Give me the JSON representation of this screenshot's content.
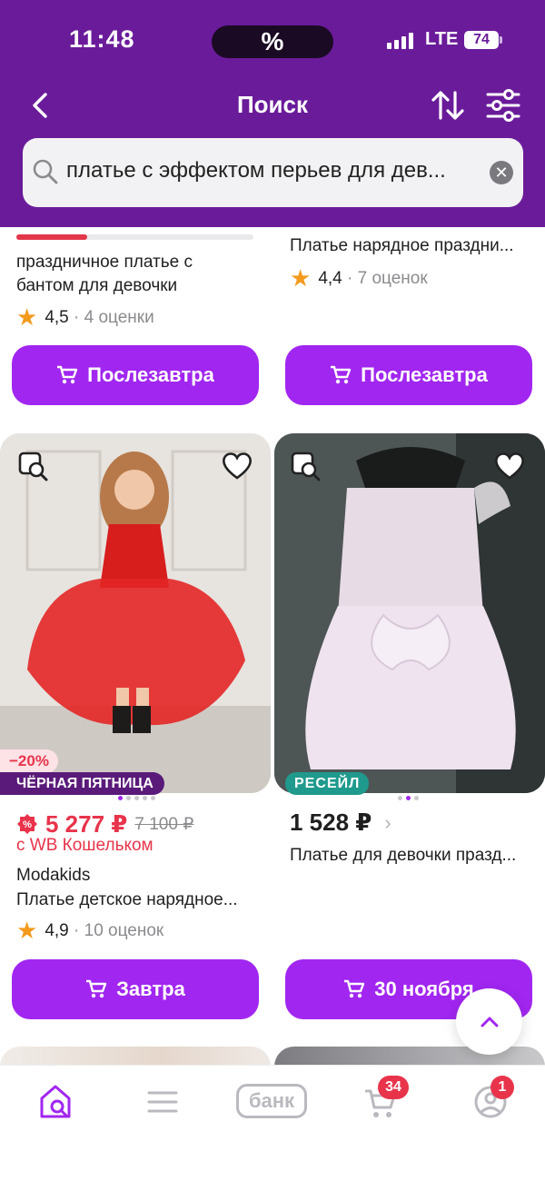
{
  "status_bar": {
    "time": "11:48",
    "island": "%",
    "network": "LTE",
    "battery": "74"
  },
  "nav": {
    "title": "Поиск",
    "back_icon": "chevron-left-icon",
    "sort_icon": "sort-arrows-icon",
    "filter_icon": "filter-sliders-icon"
  },
  "search": {
    "query": "платье с эффектом перьев для дев..."
  },
  "top_row": {
    "left": {
      "title_line1": "праздничное платье с",
      "title_line2": "бантом для девочки",
      "rating": "4,5",
      "reviews": "· 4 оценки",
      "progress": 0.3,
      "button": "Послезавтра"
    },
    "right": {
      "title": "Платье нарядное праздни...",
      "rating": "4,4",
      "reviews": "· 7 оценок",
      "button": "Послезавтра"
    }
  },
  "products": [
    {
      "discount": "−20%",
      "promo_badge": "ЧЁРНАЯ ПЯТНИЦА",
      "price": "5 277 ₽",
      "old_price": "7 100 ₽",
      "wallet_note": "с WB Кошельком",
      "brand": "Modakids",
      "title": "Платье детское нарядное...",
      "rating": "4,9",
      "reviews": "· 10 оценок",
      "button": "Завтра"
    },
    {
      "badge": "РЕСЕЙЛ",
      "price": "1 528 ₽",
      "title": "Платье для девочки празд...",
      "button": "30 ноября"
    }
  ],
  "tabbar": {
    "items": [
      "home-search-icon",
      "catalog-icon",
      "bank-icon",
      "cart-icon",
      "profile-icon"
    ],
    "bank_label": "банк",
    "cart_count": "34",
    "profile_count": "1"
  },
  "colors": {
    "header": "#6a1b9a",
    "accent": "#a126f0",
    "sale": "#e8344b",
    "star": "#f39a1d"
  }
}
